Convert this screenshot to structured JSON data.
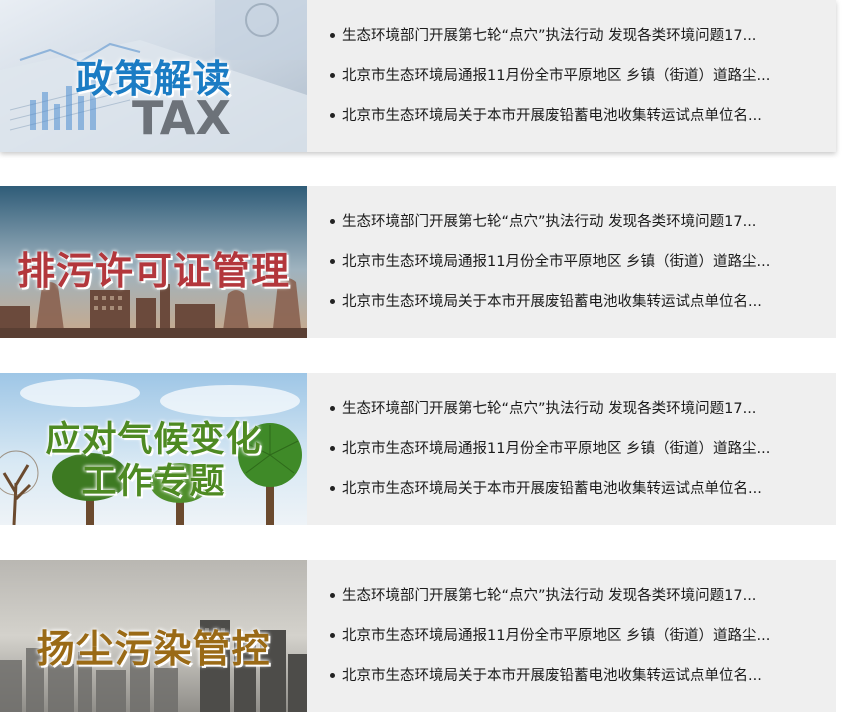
{
  "sections": [
    {
      "title": "政策解读",
      "items": [
        "生态环境部门开展第七轮“点穴”执法行动 发现各类环境问题17...",
        "北京市生态环境局通报11月份全市平原地区 乡镇（街道）道路尘...",
        "北京市生态环境局关于本市开展废铅蓄电池收集转运试点单位名..."
      ]
    },
    {
      "title": "排污许可证管理",
      "items": [
        "生态环境部门开展第七轮“点穴”执法行动 发现各类环境问题17...",
        "北京市生态环境局通报11月份全市平原地区 乡镇（街道）道路尘...",
        "北京市生态环境局关于本市开展废铅蓄电池收集转运试点单位名..."
      ]
    },
    {
      "title_line1": "应对气候变化",
      "title_line2": "工作专题",
      "items": [
        "生态环境部门开展第七轮“点穴”执法行动 发现各类环境问题17...",
        "北京市生态环境局通报11月份全市平原地区 乡镇（街道）道路尘...",
        "北京市生态环境局关于本市开展废铅蓄电池收集转运试点单位名..."
      ]
    },
    {
      "title": "扬尘污染管控",
      "items": [
        "生态环境部门开展第七轮“点穴”执法行动 发现各类环境问题17...",
        "北京市生态环境局通报11月份全市平原地区 乡镇（街道）道路尘...",
        "北京市生态环境局关于本市开展废铅蓄电池收集转运试点单位名..."
      ]
    }
  ],
  "banner_decor": {
    "tax_text": "TAX"
  },
  "colors": {
    "card_bg": "#efefef",
    "policy_title": "#1b7cc4",
    "permit_title": "#b3373c",
    "climate_title": "#4e8a22",
    "dust_title": "#9a6a16"
  }
}
